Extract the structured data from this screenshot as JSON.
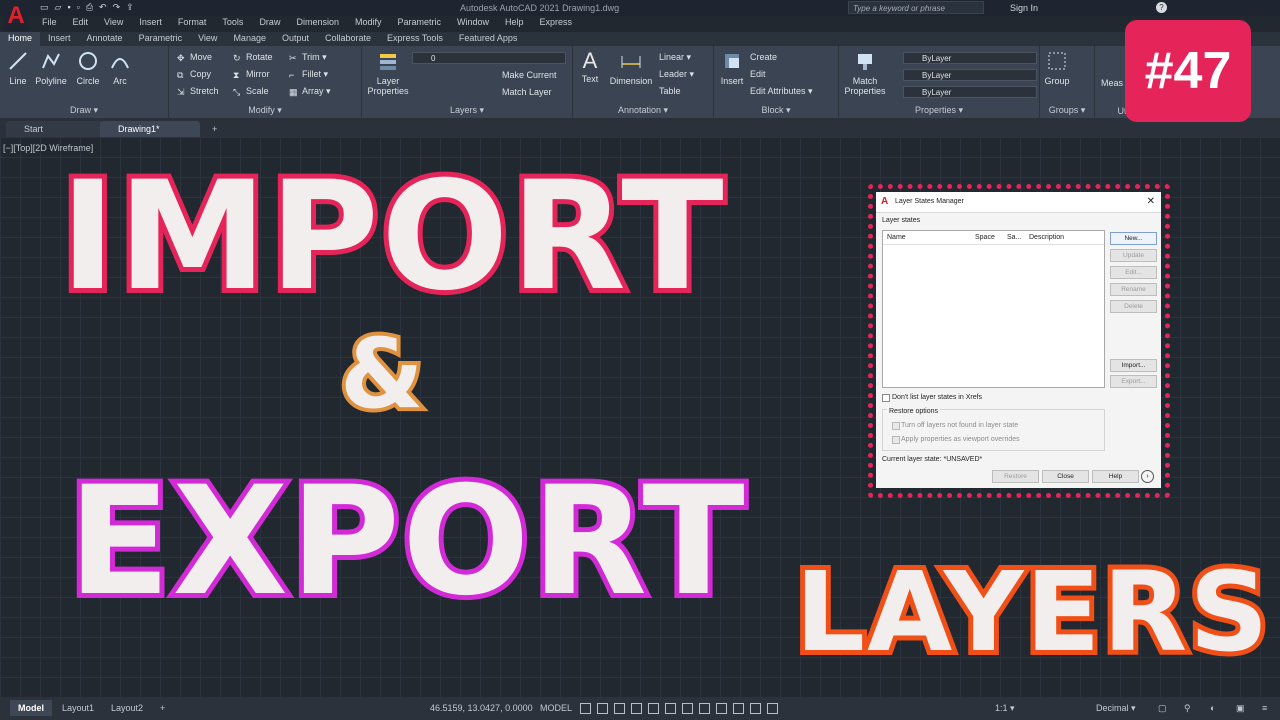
{
  "titlebar": {
    "logo": "A",
    "app_title": "Autodesk AutoCAD 2021    Drawing1.dwg",
    "search_placeholder": "Type a keyword or phrase",
    "signin": "Sign In",
    "help": "?"
  },
  "menubar": [
    "File",
    "Edit",
    "View",
    "Insert",
    "Format",
    "Tools",
    "Draw",
    "Dimension",
    "Modify",
    "Parametric",
    "Window",
    "Help",
    "Express"
  ],
  "ribbon_tabs": [
    "Home",
    "Insert",
    "Annotate",
    "Parametric",
    "View",
    "Manage",
    "Output",
    "Collaborate",
    "Express Tools",
    "Featured Apps"
  ],
  "ribbon": {
    "draw": {
      "title": "Draw ▾",
      "line": "Line",
      "polyline": "Polyline",
      "circle": "Circle",
      "arc": "Arc"
    },
    "modify": {
      "title": "Modify ▾",
      "move": "Move",
      "rotate": "Rotate",
      "trim": "Trim ▾",
      "copy": "Copy",
      "mirror": "Mirror",
      "fillet": "Fillet ▾",
      "stretch": "Stretch",
      "scale": "Scale",
      "array": "Array ▾"
    },
    "layers": {
      "title": "Layers ▾",
      "layer_properties": "Layer Properties",
      "layer_value": "0",
      "make_current": "Make Current",
      "match_layer": "Match Layer"
    },
    "annotation": {
      "title": "Annotation ▾",
      "text": "Text",
      "dimension": "Dimension",
      "linear": "Linear ▾",
      "leader": "Leader ▾",
      "table": "Table"
    },
    "block": {
      "title": "Block ▾",
      "insert": "Insert",
      "create": "Create",
      "edit": "Edit",
      "edit_attributes": "Edit Attributes ▾"
    },
    "properties": {
      "title": "Properties ▾",
      "match_properties": "Match Properties",
      "bylayer1": "ByLayer",
      "bylayer2": "ByLayer",
      "bylayer3": "ByLayer"
    },
    "groups": {
      "title": "Groups ▾",
      "group": "Group"
    },
    "utilities": {
      "title": "Utili",
      "measure": "Meas"
    }
  },
  "file_tabs": [
    "Start",
    "Drawing1*",
    "+"
  ],
  "viewport_label": "[−][Top][2D Wireframe]",
  "badge": "#47",
  "headline": {
    "import": "IMPORT",
    "amp": "&",
    "export": "EXPORT",
    "layers": "LAYERS"
  },
  "dialog": {
    "title": "Layer States Manager",
    "close": "✕",
    "layer_states_label": "Layer states",
    "columns": [
      "Name",
      "Space",
      "Sa...",
      "Description"
    ],
    "buttons": {
      "new": "New...",
      "update": "Update",
      "edit": "Edit...",
      "rename": "Rename",
      "delete": "Delete",
      "import": "Import...",
      "export": "Export..."
    },
    "dont_list": "Don't list layer states in Xrefs",
    "restore_options": "Restore options",
    "turn_off": "Turn off layers not found in layer state",
    "apply_props": "Apply properties as viewport overrides",
    "current_state": "Current layer state: *UNSAVED*",
    "restore_btn": "Restore",
    "close_btn": "Close",
    "help_btn": "Help"
  },
  "statusbar": {
    "tabs": [
      "Model",
      "Layout1",
      "Layout2",
      "+"
    ],
    "coords": "46.5159, 13.0427, 0.0000",
    "mode": "MODEL",
    "scale": "1:1 ▾",
    "units": "Decimal ▾"
  },
  "colors": {
    "badge": "#e5255a",
    "import_stroke": "#e5255a",
    "amp_stroke": "#e0923f",
    "export_stroke": "#d32ad8",
    "layers_stroke": "#f04f17"
  }
}
